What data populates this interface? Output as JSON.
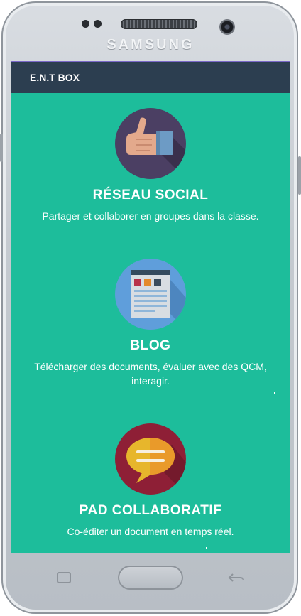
{
  "device": {
    "brand": "SAMSUNG"
  },
  "appbar": {
    "title": "E.N.T BOX"
  },
  "features": [
    {
      "title": "RÉSEAU SOCIAL",
      "description": "Partager et collaborer en groupes dans la classe.",
      "icon": "thumbs-up-icon"
    },
    {
      "title": "BLOG",
      "description": "Télécharger des documents, évaluer avec des QCM, interagir.",
      "icon": "newspaper-icon"
    },
    {
      "title": "PAD COLLABORATIF",
      "description": "Co-éditer un document en temps réel.",
      "icon": "speech-bubble-icon"
    }
  ],
  "colors": {
    "screen_bg": "#1dbd9b",
    "appbar_bg": "#2c3e50",
    "text": "#ffffff"
  }
}
